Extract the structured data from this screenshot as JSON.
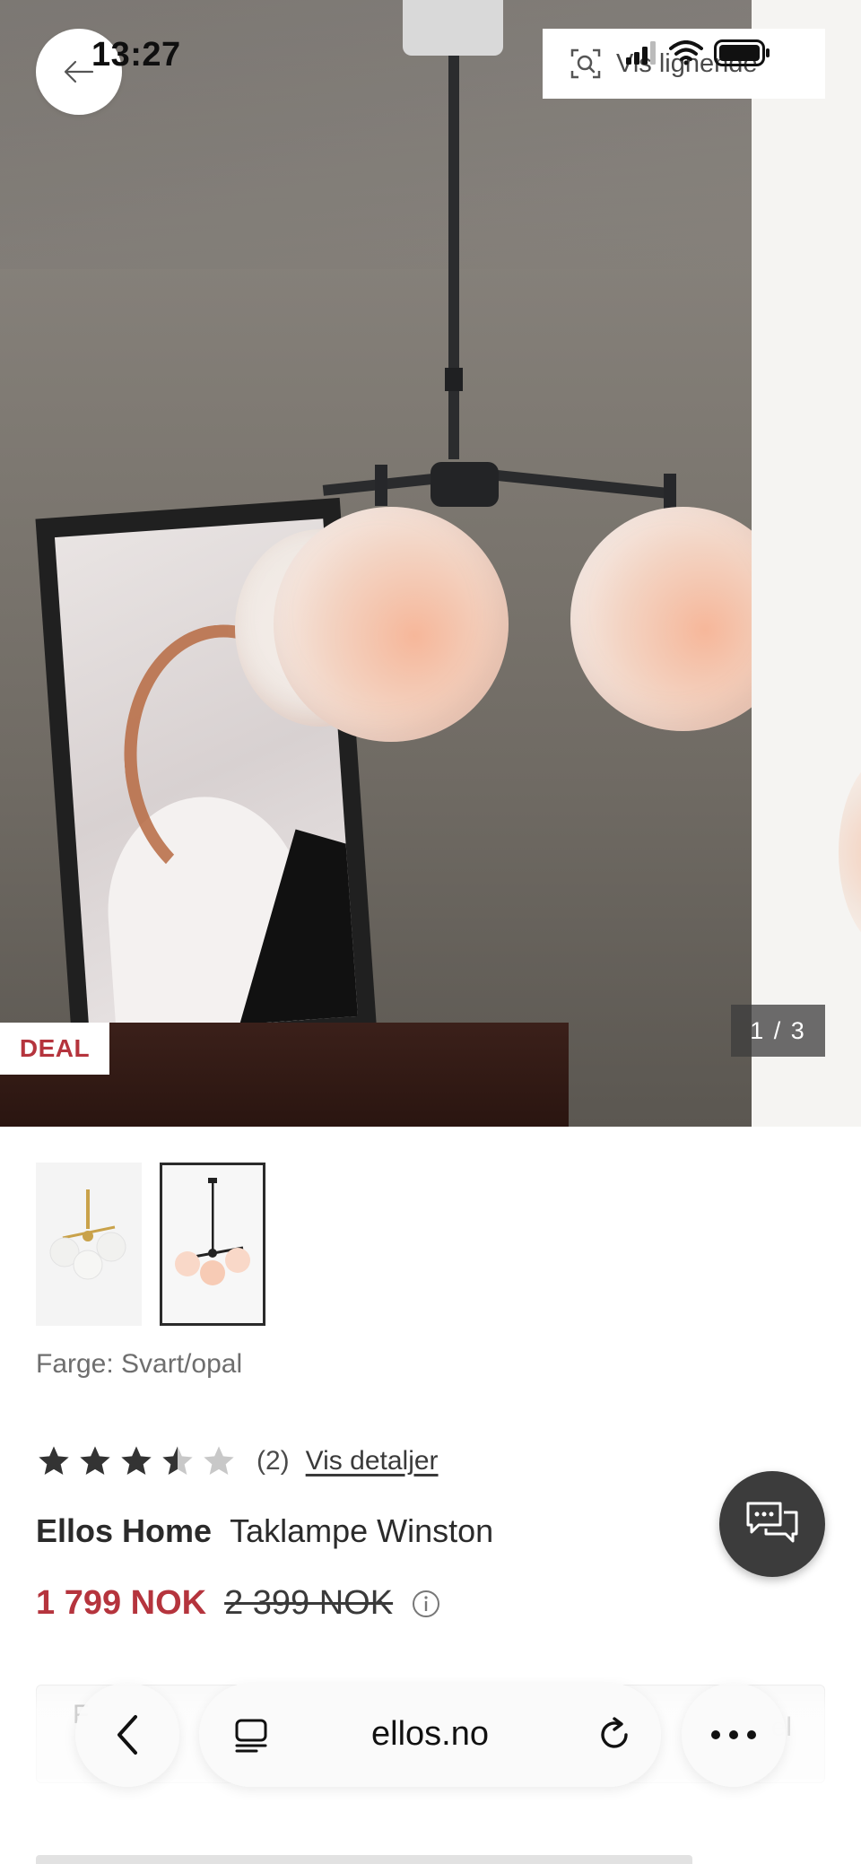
{
  "status_bar": {
    "time": "13:27"
  },
  "hero": {
    "similar_label": "Vis lignende",
    "deal_badge": "DEAL",
    "image_counter": "1 / 3"
  },
  "product": {
    "color_label": "Farge: Svart/opal",
    "rating": 3.5,
    "rating_max": 5,
    "review_count": "(2)",
    "details_link": "Vis detaljer",
    "brand": "Ellos Home",
    "name": "Taklampe Winston",
    "price_now": "1 799 NOK",
    "price_old": "2 399 NOK"
  },
  "info_box": {
    "left_text": "F",
    "right_text": "el"
  },
  "browser": {
    "url": "ellos.no"
  },
  "colors": {
    "accent": "#b5343d",
    "dark": "#3c3c3c"
  },
  "icons": [
    "arrow-left-icon",
    "visual-search-icon",
    "signal-icon",
    "wifi-icon",
    "battery-icon",
    "star-icon",
    "info-icon",
    "chat-icon",
    "chevron-left-icon",
    "tabs-icon",
    "reload-icon",
    "more-icon"
  ]
}
